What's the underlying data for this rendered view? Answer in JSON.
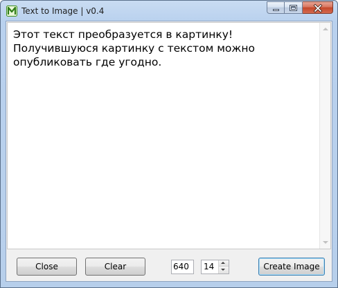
{
  "window": {
    "title": "Text to Image | v0.4",
    "app_icon": "app-logo-icon"
  },
  "caption_buttons": {
    "minimize_icon": "minimize-icon",
    "maximize_icon": "maximize-icon",
    "close_icon": "close-icon"
  },
  "editor": {
    "text": "Этот текст преобразуется в картинку!\nПолучившуюся картинку с текстом можно\nопубликовать где угодно."
  },
  "toolbar": {
    "close_label": "Close",
    "clear_label": "Clear",
    "width_value": "640",
    "font_size_value": "14",
    "create_label": "Create Image"
  },
  "colors": {
    "titlebar": "#b9d1ee",
    "close_button": "#c4472a",
    "default_button_border": "#3c7fb1",
    "client_background": "#f0f0f0"
  }
}
